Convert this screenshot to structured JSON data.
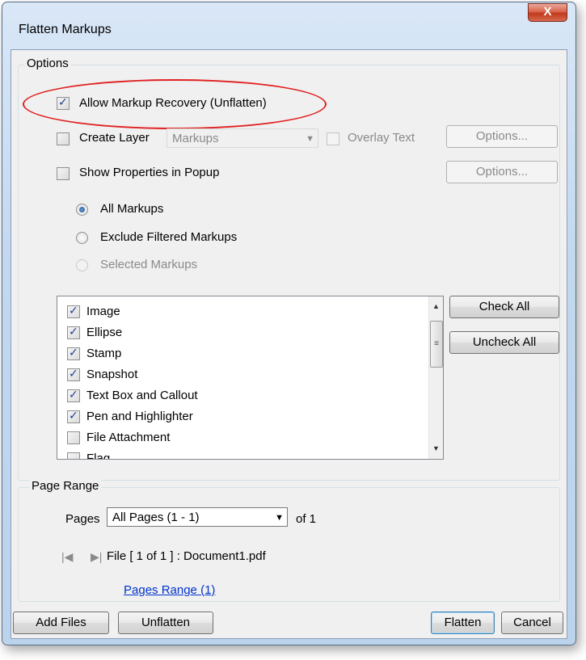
{
  "window": {
    "title": "Flatten Markups",
    "close_label": "X"
  },
  "options": {
    "legend": "Options",
    "allow_recovery": {
      "label": "Allow Markup Recovery (Unflatten)",
      "checked": true
    },
    "create_layer": {
      "label": "Create Layer",
      "checked": false,
      "layer_value": "Markups"
    },
    "overlay_text": {
      "label": "Overlay Text",
      "checked": false
    },
    "options_button_1": "Options...",
    "show_properties": {
      "label": "Show Properties in Popup",
      "checked": false
    },
    "options_button_2": "Options...",
    "radios": {
      "all": "All Markups",
      "exclude": "Exclude Filtered Markups",
      "selected": "Selected Markups"
    },
    "markup_types": [
      {
        "label": "Image",
        "checked": true
      },
      {
        "label": "Ellipse",
        "checked": true
      },
      {
        "label": "Stamp",
        "checked": true
      },
      {
        "label": "Snapshot",
        "checked": true
      },
      {
        "label": "Text Box and Callout",
        "checked": true
      },
      {
        "label": "Pen and Highlighter",
        "checked": true
      },
      {
        "label": "File Attachment",
        "checked": false
      },
      {
        "label": "Flag",
        "checked": false
      }
    ],
    "check_all": "Check All",
    "uncheck_all": "Uncheck All"
  },
  "page_range": {
    "legend": "Page Range",
    "pages_label": "Pages",
    "pages_value": "All Pages (1 - 1)",
    "of_label": "of 1",
    "file_label": "File [ 1 of 1 ] :  Document1.pdf",
    "range_link": "Pages Range (1)"
  },
  "footer": {
    "add_files": "Add Files",
    "unflatten": "Unflatten",
    "flatten": "Flatten",
    "cancel": "Cancel"
  },
  "colors": {
    "highlight": "#e02020",
    "link": "#0033cc",
    "accent": "#3c7fb1"
  }
}
